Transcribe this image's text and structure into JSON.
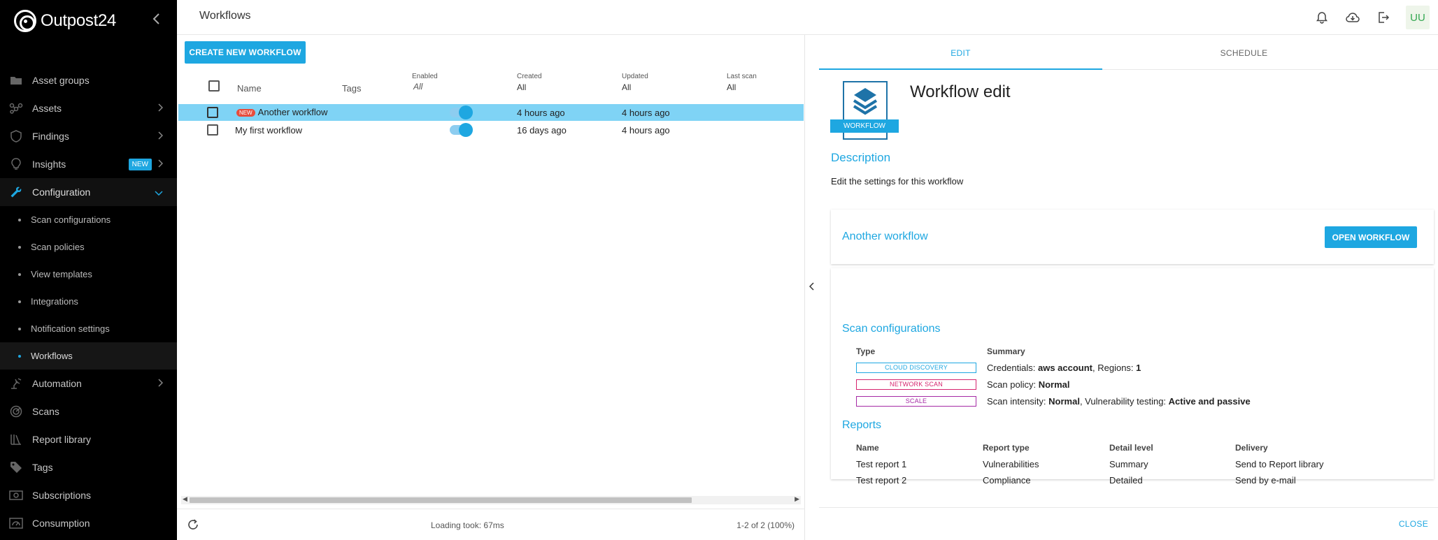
{
  "brand": {
    "name": "Outpost24"
  },
  "sidebar": {
    "items": [
      {
        "label": "Asset groups",
        "icon": "folder-icon"
      },
      {
        "label": "Assets",
        "icon": "network-icon"
      },
      {
        "label": "Findings",
        "icon": "shield-icon"
      },
      {
        "label": "Insights",
        "icon": "lightbulb-icon",
        "badge": "NEW"
      },
      {
        "label": "Configuration",
        "icon": "wrench-icon"
      },
      {
        "label": "Automation",
        "icon": "robot-arm-icon"
      },
      {
        "label": "Scans",
        "icon": "radar-icon"
      },
      {
        "label": "Report library",
        "icon": "library-icon"
      },
      {
        "label": "Tags",
        "icon": "tag-icon"
      },
      {
        "label": "Subscriptions",
        "icon": "money-icon"
      },
      {
        "label": "Consumption",
        "icon": "gauge-icon"
      }
    ],
    "sub_items": [
      "Scan configurations",
      "Scan policies",
      "View templates",
      "Integrations",
      "Notification settings",
      "Workflows"
    ]
  },
  "header": {
    "title": "Workflows",
    "avatar": "UU"
  },
  "list": {
    "create_label": "CREATE NEW WORKFLOW",
    "columns": {
      "name": "Name",
      "tags": "Tags",
      "enabled": "Enabled",
      "enabled_filter": "All",
      "created": "Created",
      "created_filter": "All",
      "updated": "Updated",
      "updated_filter": "All",
      "last_scan": "Last scan",
      "last_scan_filter": "All"
    },
    "rows": [
      {
        "badge": "NEW",
        "name": "Another workflow",
        "enabled": true,
        "created": "4 hours ago",
        "updated": "4 hours ago"
      },
      {
        "name": "My first workflow",
        "enabled": true,
        "created": "16 days ago",
        "updated": "4 hours ago"
      }
    ],
    "footer": {
      "loading": "Loading took: 67ms",
      "pagination": "1-2 of 2 (100%)"
    }
  },
  "detail": {
    "tabs": {
      "edit": "EDIT",
      "schedule": "SCHEDULE"
    },
    "icon_label": "WORKFLOW",
    "title": "Workflow edit",
    "description_heading": "Description",
    "description_text": "Edit the settings for this workflow",
    "workflow_name": "Another workflow",
    "open_label": "OPEN WORKFLOW",
    "scan_config_heading": "Scan configurations",
    "scan_config_cols": {
      "type": "Type",
      "summary": "Summary"
    },
    "scan_configs": [
      {
        "type": "CLOUD DISCOVERY",
        "color": "#1ea7e1",
        "s1": "Credentials: ",
        "b1": "aws account",
        "s2": ", Regions: ",
        "b2": "1"
      },
      {
        "type": "NETWORK SCAN",
        "color": "#d6246e",
        "s1": "Scan policy: ",
        "b1": "Normal",
        "s2": "",
        "b2": ""
      },
      {
        "type": "SCALE",
        "color": "#a52aa5",
        "s1": "Scan intensity: ",
        "b1": "Normal",
        "s2": ", Vulnerability testing: ",
        "b2": "Active and passive"
      }
    ],
    "reports_heading": "Reports",
    "report_cols": {
      "name": "Name",
      "type": "Report type",
      "detail": "Detail level",
      "delivery": "Delivery"
    },
    "reports": [
      {
        "name": "Test report 1",
        "type": "Vulnerabilities",
        "detail": "Summary",
        "delivery": "Send to Report library"
      },
      {
        "name": "Test report 2",
        "type": "Compliance",
        "detail": "Detailed",
        "delivery": "Send by e-mail"
      }
    ],
    "close_label": "CLOSE"
  }
}
